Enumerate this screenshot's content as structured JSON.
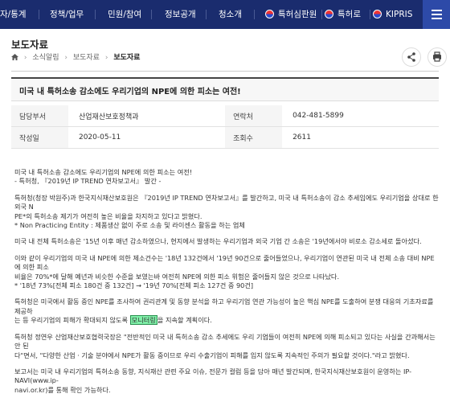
{
  "topnav": {
    "items": [
      "자/통계",
      "정책/업무",
      "민원/참여",
      "정보공개",
      "청소개"
    ],
    "links": [
      "특허심판원",
      "특허로",
      "KIPRIS"
    ],
    "colors": {
      "bar": "#1a2c6e",
      "menu": "#2d4aa8"
    }
  },
  "header": {
    "title": "보도자료",
    "breadcrumb": [
      "소식알림",
      "보도자료",
      "보도자료"
    ],
    "share_icon": "share-icon",
    "print_icon": "print-icon"
  },
  "article": {
    "title": "미국 내 특허소송 감소에도 우리기업의 NPE에 의한 피소는 여전!",
    "meta": {
      "dept_label": "담당부서",
      "dept_value": "산업재산보호정책과",
      "contact_label": "연락처",
      "contact_value": "042-481-5899",
      "date_label": "작성일",
      "date_value": "2020-05-11",
      "views_label": "조회수",
      "views_value": "2611"
    },
    "body": {
      "p1": [
        "미국 내 특허소송 감소에도 우리기업의 NPE에 의한 피소는 여전!",
        "- 특허청, 『2019년 IP TREND 연차보고서』 발간 -"
      ],
      "p2": [
        "특허청(청장 박원주)과 한국지식재산보호원은 『2019년 IP TREND 연차보고서』를 발간하고, 미국 내 특허소송이 감소 추세임에도 우리기업을 상대로 한 외국 N",
        "PE*의 특허소송 제기가 여전히 높은 비율을 차지하고 있다고 밝혔다.",
        "* Non Practicing Entity : 제품생산 없이 주로 소송 및 라이센스 활동을 하는 업체"
      ],
      "p3": [
        "미국 내 전체 특허소송은 '15년 이후 매년 감소하였으나, 현지에서 발생하는 우리기업과 외국 기업 간 소송은 '19년에서야 비로소 감소세로 돌아섰다."
      ],
      "p4": [
        "이와 같이 우리기업의 미국 내 NPE에 의한 제소건수는 '18년 132건에서 '19년 90건으로 줄어들었으나, 우리기업이 연관된 미국 내 전체 소송 대비 NPE에 의한 피소",
        " 비율은 70%*에 달해 예년과 비슷한 수준을 보였는바 여전히 NPE에 의한 피소 위험은 줄어들지 않은 것으로 나타났다.",
        "* '18년 73%[전체 피소 180건 중 132건] → '19년 70%[전체 피소 127건 중 90건]"
      ],
      "p5_a": "특허청은 미국에서 활동 중인 NPE를 조사하여 권리관계 및 동향 분석을 하고 우리기업 연관 가능성이 높은 핵심 NPE를 도출하여 분쟁 대응의 기초자료를 제공하",
      "p5_b": "는 등 우리기업의 피해가 확대되지 않도록 ",
      "p5_hl": "모니터링",
      "p5_c": "을 지속할 계획이다.",
      "p6": [
        "특허청 정연우 산업재산보호협력국장은 \"전반적인 미국 내 특허소송 감소 추세에도 우리 기업들이 여전히 NPE에 의해 피소되고 있다는 사실을 간과해서는 안 된",
        "다\"면서, \"다양한 산업 · 기술 분야에서 NPE가 활동 중이므로 우리 수출기업이 피해를 입지 않도록 지속적인 주의가 필요할 것이다.\"라고 밝혔다."
      ],
      "p7": [
        "보고서는 미국 내 우리기업의 특허소송 동향, 지식재산 관련 주요 이슈, 전문가 컬럼 등을 담아 매년 발간되며, 한국지식재산보호원이 운영하는 IP-NAVI(www.ip-",
        "navi.or.kr)를 통해 확인 가능하다."
      ]
    }
  }
}
